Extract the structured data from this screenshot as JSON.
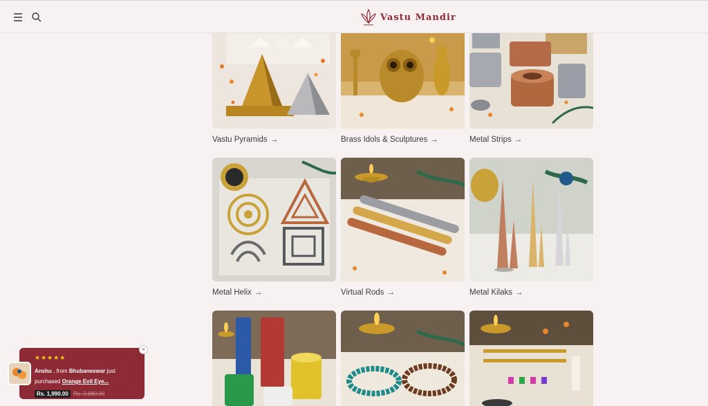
{
  "header": {
    "brand": "Vastu Mandir",
    "icons": [
      "menu-icon",
      "search-icon"
    ],
    "brand_color": "#8e2a35"
  },
  "categories": [
    {
      "label": "Vastu Pyramids",
      "arrow": "→"
    },
    {
      "label": "Brass Idols & Sculptures",
      "arrow": "→"
    },
    {
      "label": "Metal Strips",
      "arrow": "→"
    },
    {
      "label": "Metal Helix",
      "arrow": "→"
    },
    {
      "label": "Virtual Rods",
      "arrow": "→"
    },
    {
      "label": "Metal Kilaks",
      "arrow": "→"
    }
  ],
  "toast": {
    "stars": "★★★★★",
    "name": "Anshu .",
    "from": "from",
    "city": "Bhubaneswar",
    "just": "just",
    "purchased": "purchased",
    "product": "Orange Evil Eye...",
    "price": "Rs. 1,990.00",
    "old_price": "Rs. 2,880.00",
    "close": "×"
  }
}
